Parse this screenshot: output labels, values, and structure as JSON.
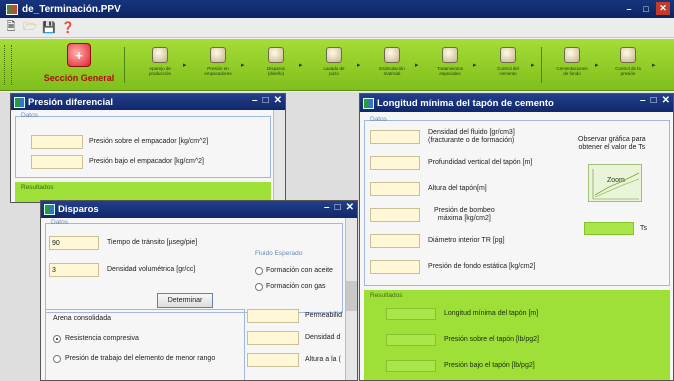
{
  "window": {
    "title": "de_Terminación.PPV"
  },
  "toolbar": {
    "icons": [
      "new-file-icon",
      "open-folder-icon",
      "save-icon",
      "help-icon"
    ]
  },
  "ribbon": {
    "main": "Sección General",
    "buttons": [
      {
        "label": "Aparejo de\nproducción"
      },
      {
        "label": "Presión en\nempacadores"
      },
      {
        "label": "Disparos\n(diseño)"
      },
      {
        "label": "Lavado de\npozo"
      },
      {
        "label": "Estimulación\nmatricial"
      },
      {
        "label": "Tratamientos\nespeciales"
      },
      {
        "label": "Control del\ncemento"
      },
      {
        "label": "Cementaciones\nde fondo"
      },
      {
        "label": "Control de la\npresión"
      }
    ]
  },
  "win_presion": {
    "title": "Presión diferencial",
    "group": "Datos",
    "fields": [
      {
        "label": "Presión sobre el empacador  [kg/cm^2]",
        "value": ""
      },
      {
        "label": "Presión bajo el empacador  [kg/cm^2]",
        "value": ""
      }
    ],
    "results_label": "Resultados"
  },
  "win_disparos": {
    "title": "Disparos",
    "group": "Datos",
    "fields": [
      {
        "label": "Tiempo de tránsito [µseg/pie]",
        "value": "90"
      },
      {
        "label": "Densidad volumétrica [gr/cc]",
        "value": "3"
      }
    ],
    "fluido_label": "Fluido Esperado",
    "fluido_options": [
      "Formación con aceite",
      "Formación con gas"
    ],
    "determinar": "Determinar",
    "arena": "Arena consolidada",
    "radios": [
      "Resistencia compresiva",
      "Presión de trabajo del elemento de menor rango"
    ],
    "right_labels": [
      "Permeabilid",
      "Densidad d",
      "Altura a la ("
    ]
  },
  "win_longitud": {
    "title": "Longitud mínima del tapón de cemento",
    "group": "Datos",
    "fields": [
      {
        "label": "Densidad del fluido [gr/cm3]\n(fracturante o de formación)"
      },
      {
        "label": "Profundidad vertical del tapón [m]"
      },
      {
        "label": "Altura del tapón[m]"
      },
      {
        "label": "Presión de bombeo\nmáxima [kg/cm2]"
      },
      {
        "label": "Diámetro interior TR [pg]"
      },
      {
        "label": "Presión de fondo estática [kg/cm2]"
      }
    ],
    "note": "Observar gráfica para\nobtener el valor de Ts",
    "zoom": "Zoom",
    "ts": "Ts",
    "results_label": "Resultados",
    "results": [
      "Longitud mínima del tapón [m]",
      "Presión sobre el tapón [lb/pg2]",
      "Presión bajo el tapón [lb/pg2]"
    ]
  }
}
